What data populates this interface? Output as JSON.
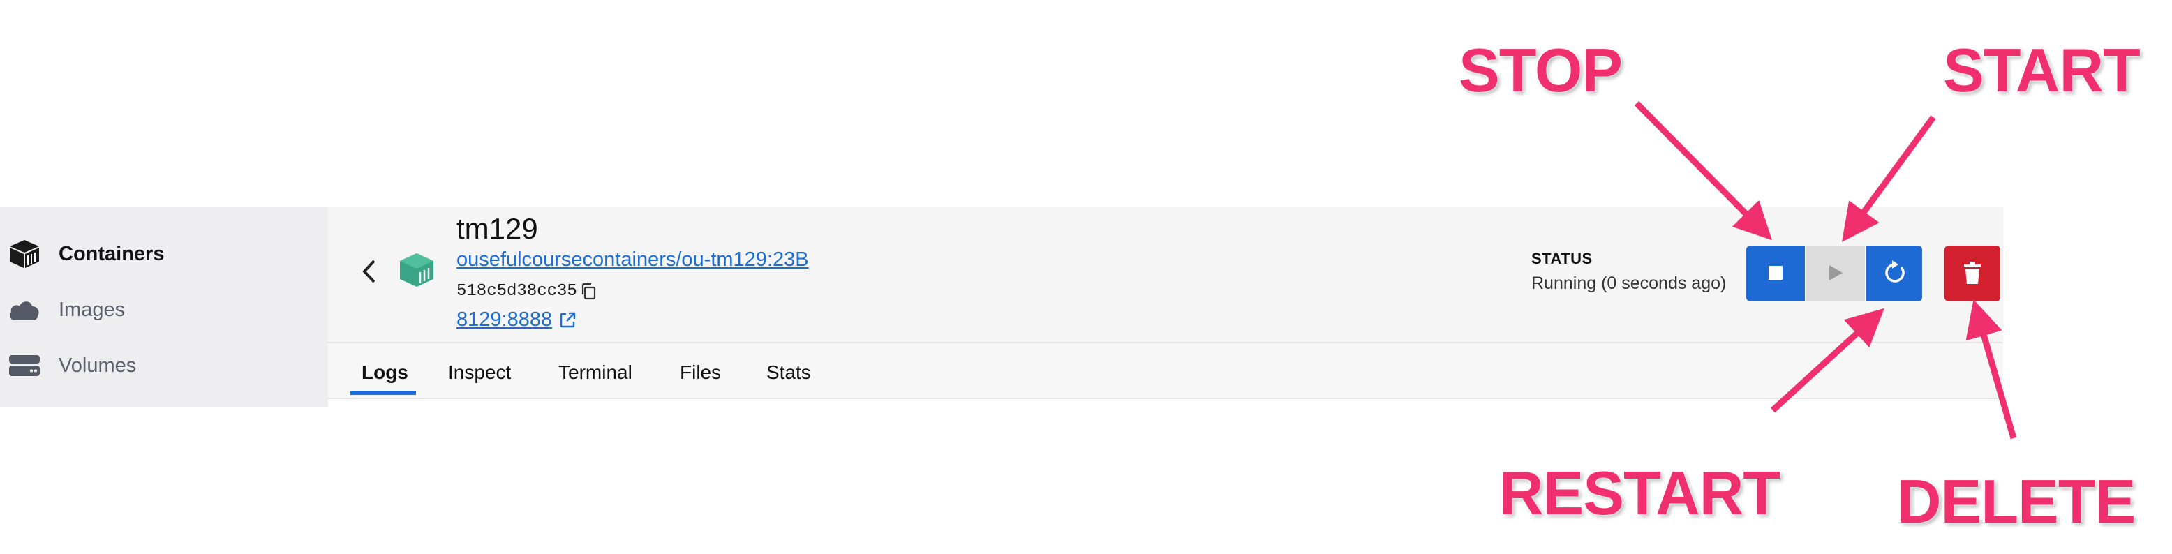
{
  "sidebar": {
    "items": [
      {
        "label": "Containers",
        "icon": "containers-icon",
        "active": true
      },
      {
        "label": "Images",
        "icon": "cloud-icon",
        "active": false
      },
      {
        "label": "Volumes",
        "icon": "volume-drive-icon",
        "active": false
      }
    ]
  },
  "container": {
    "name": "tm129",
    "image": "ousefulcoursecontainers/ou-tm129:23B",
    "id": "518c5d38cc35",
    "port": "8129:8888",
    "status_label": "STATUS",
    "status_value": "Running (0 seconds ago)"
  },
  "actions": {
    "stop": "stop-icon",
    "start": "play-icon",
    "restart": "restart-icon",
    "delete": "trash-icon"
  },
  "tabs": [
    "Logs",
    "Inspect",
    "Terminal",
    "Files",
    "Stats"
  ],
  "active_tab": "Logs",
  "annotations": {
    "stop": "STOP",
    "start": "START",
    "restart": "RESTART",
    "delete": "DELETE"
  },
  "colors": {
    "accent": "#1d6ad4",
    "danger": "#d2202f",
    "annotation": "#f0306e",
    "sidebar_bg": "#eeeef1"
  }
}
